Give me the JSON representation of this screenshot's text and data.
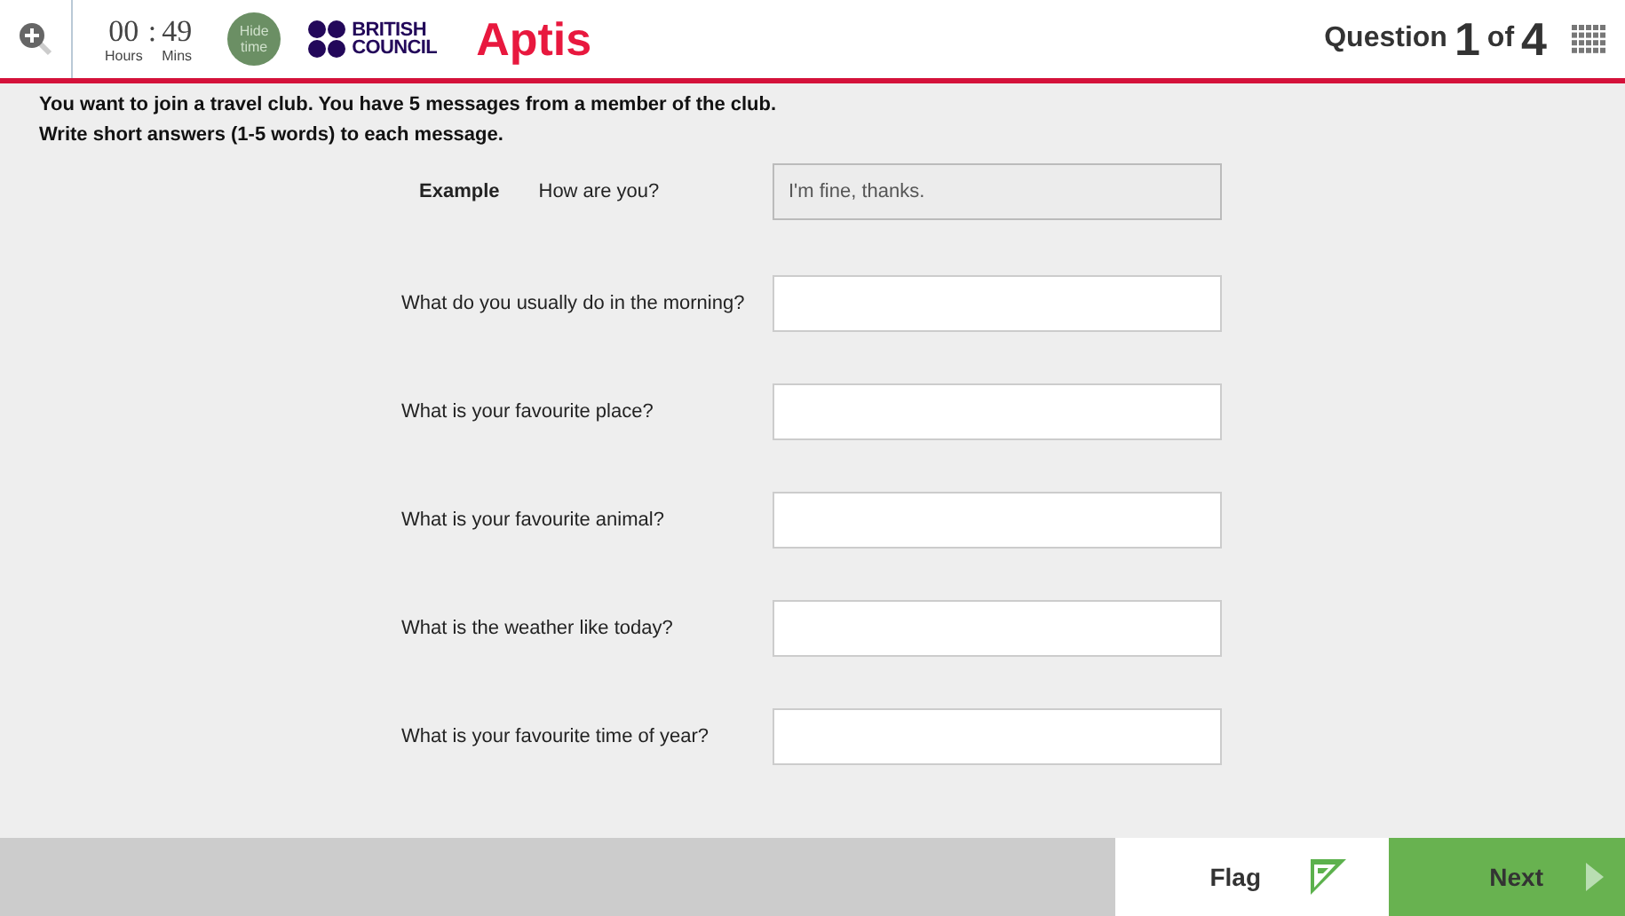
{
  "header": {
    "timer": {
      "hours": "00",
      "separator": ":",
      "minutes": "49",
      "hours_label": "Hours",
      "minutes_label": "Mins"
    },
    "hide_time_button": "Hide time",
    "logo": {
      "line_1": "BRITISH",
      "line_2": "COUNCIL"
    },
    "product": "Aptis",
    "question": {
      "label": "Question",
      "current": "1",
      "of": "of",
      "total": "4"
    }
  },
  "instructions": [
    "You want to join a travel club. You have 5 messages from a member of the club.",
    "Write short answers (1-5 words) to each message."
  ],
  "example": {
    "label": "Example",
    "question": "How are you?",
    "answer": "I'm fine, thanks."
  },
  "questions": [
    {
      "text": "What do you usually do in the morning?"
    },
    {
      "text": "What is your favourite place?"
    },
    {
      "text": "What is your favourite animal?"
    },
    {
      "text": "What is the weather like today?"
    },
    {
      "text": "What is your favourite time of year?"
    }
  ],
  "footer": {
    "flag_button": "Flag",
    "next_button": "Next"
  }
}
